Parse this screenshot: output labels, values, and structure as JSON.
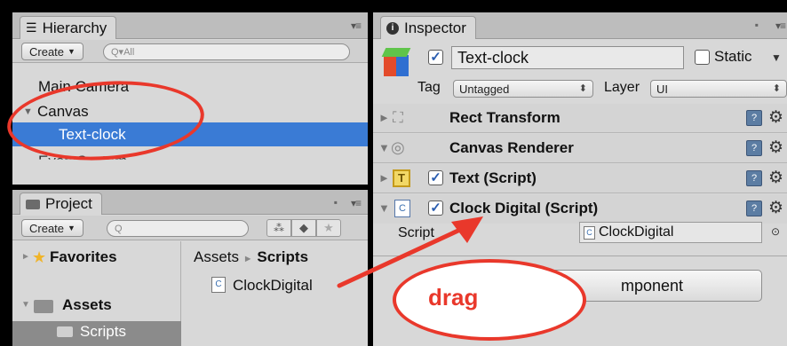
{
  "hierarchy": {
    "tab_label": "Hierarchy",
    "create_label": "Create",
    "search_placeholder": "Q▾All",
    "items": [
      "Main Camera",
      "Canvas",
      "Text-clock",
      "EventSystem"
    ]
  },
  "project": {
    "tab_label": "Project",
    "create_label": "Create",
    "search_placeholder": "Q",
    "favorites_label": "Favorites",
    "assets_label": "Assets",
    "scripts_folder_label": "Scripts",
    "breadcrumb_root": "Assets",
    "breadcrumb_separator": "►",
    "breadcrumb_current": "Scripts",
    "file_name": "ClockDigital"
  },
  "inspector": {
    "tab_label": "Inspector",
    "object_name": "Text-clock",
    "static_label": "Static",
    "tag_label": "Tag",
    "tag_value": "Untagged",
    "layer_label": "Layer",
    "layer_value": "UI",
    "components": [
      {
        "name": "Rect Transform"
      },
      {
        "name": "Canvas Renderer"
      },
      {
        "name": "Text (Script)"
      },
      {
        "name": "Clock Digital (Script)"
      }
    ],
    "script_field_label": "Script",
    "script_field_value": "ClockDigital",
    "add_component_label": "mponent"
  },
  "annotation": {
    "drag_label": "drag",
    "color": "#e9382b"
  }
}
